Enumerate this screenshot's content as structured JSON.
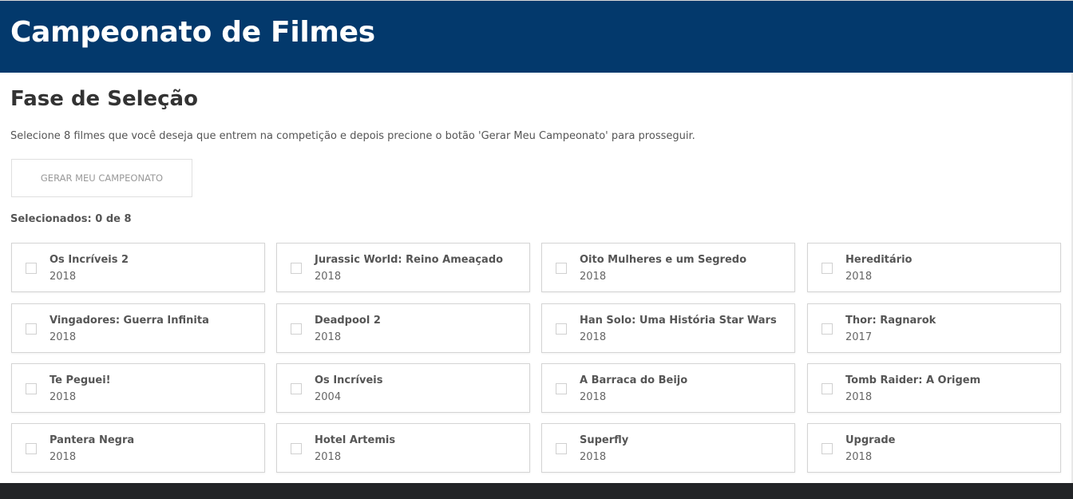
{
  "header": {
    "title": "Campeonato de Filmes"
  },
  "phase": {
    "title": "Fase de Seleção",
    "instructions": "Selecione 8 filmes que você deseja que entrem na competição e depois precione o botão 'Gerar Meu Campeonato' para prosseguir.",
    "button_label": "Gerar Meu Campeonato",
    "counter": "Selecionados: 0 de 8"
  },
  "movies": [
    {
      "title": "Os Incríveis 2",
      "year": "2018",
      "selected": false
    },
    {
      "title": "Jurassic World: Reino Ameaçado",
      "year": "2018",
      "selected": false
    },
    {
      "title": "Oito Mulheres e um Segredo",
      "year": "2018",
      "selected": false
    },
    {
      "title": "Hereditário",
      "year": "2018",
      "selected": false
    },
    {
      "title": "Vingadores: Guerra Infinita",
      "year": "2018",
      "selected": false
    },
    {
      "title": "Deadpool 2",
      "year": "2018",
      "selected": false
    },
    {
      "title": "Han Solo: Uma História Star Wars",
      "year": "2018",
      "selected": false
    },
    {
      "title": "Thor: Ragnarok",
      "year": "2017",
      "selected": false
    },
    {
      "title": "Te Peguei!",
      "year": "2018",
      "selected": false
    },
    {
      "title": "Os Incríveis",
      "year": "2004",
      "selected": false
    },
    {
      "title": "A Barraca do Beijo",
      "year": "2018",
      "selected": false
    },
    {
      "title": "Tomb Raider: A Origem",
      "year": "2018",
      "selected": false
    },
    {
      "title": "Pantera Negra",
      "year": "2018",
      "selected": false
    },
    {
      "title": "Hotel Artemis",
      "year": "2018",
      "selected": false
    },
    {
      "title": "Superfly",
      "year": "2018",
      "selected": false
    },
    {
      "title": "Upgrade",
      "year": "2018",
      "selected": false
    }
  ],
  "colors": {
    "header_bg": "#03396c",
    "footer_bg": "#222426"
  }
}
